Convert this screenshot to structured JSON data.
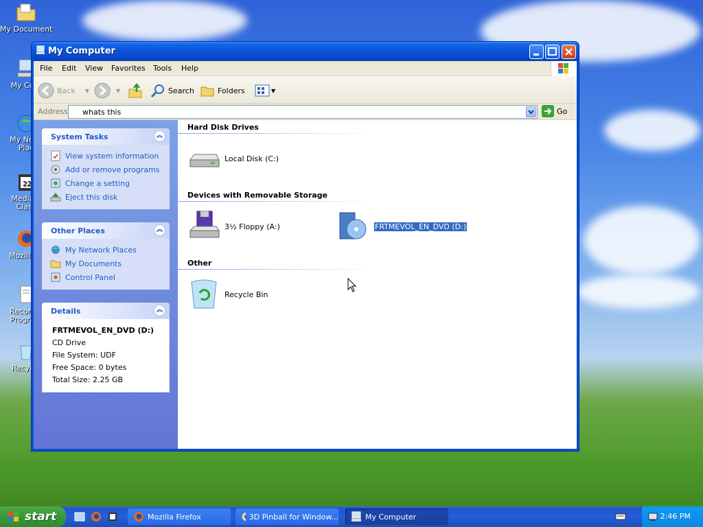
{
  "desktop": {
    "icons": [
      {
        "label": "My Documents",
        "icon": "folder-documents-icon"
      },
      {
        "label": "My Com",
        "icon": "my-computer-icon"
      },
      {
        "label": "My Netw\nPlac",
        "icon": "network-places-icon"
      },
      {
        "label": "Media P\nClass",
        "icon": "media-player-icon"
      },
      {
        "label": "Mozilla Fi",
        "icon": "firefox-icon"
      },
      {
        "label": "Recomm\nProgram",
        "icon": "document-icon"
      },
      {
        "label": "Recycle",
        "icon": "recycle-bin-icon"
      }
    ]
  },
  "window": {
    "title": "My Computer",
    "menu": [
      "File",
      "Edit",
      "View",
      "Favorites",
      "Tools",
      "Help"
    ],
    "toolbar": {
      "back": "Back",
      "search": "Search",
      "folders": "Folders"
    },
    "address": {
      "label": "Address",
      "value": "whats this",
      "go": "Go"
    },
    "taskpane": {
      "system_tasks": {
        "title": "System Tasks",
        "links": [
          "View system information",
          "Add or remove programs",
          "Change a setting",
          "Eject this disk"
        ]
      },
      "other_places": {
        "title": "Other Places",
        "links": [
          "My Network Places",
          "My Documents",
          "Control Panel"
        ]
      },
      "details": {
        "title": "Details",
        "name": "FRTMEVOL_EN_DVD (D:)",
        "type": "CD Drive",
        "file_system": "File System: UDF",
        "free_space": "Free Space: 0 bytes",
        "total_size": "Total Size: 2.25 GB"
      }
    },
    "groups": {
      "hdd": {
        "title": "Hard Disk Drives",
        "items": [
          "Local Disk (C:)"
        ]
      },
      "removable": {
        "title": "Devices with Removable Storage",
        "items": [
          "3½ Floppy (A:)",
          "FRTMEVOL_EN_DVD (D:)"
        ]
      },
      "other": {
        "title": "Other",
        "items": [
          "Recycle Bin"
        ]
      }
    }
  },
  "taskbar": {
    "start": "start",
    "tasks": [
      "Mozilla Firefox",
      "3D Pinball for Window...",
      "My Computer"
    ],
    "clock": "2:46 PM"
  },
  "colors": {
    "xp_blue": "#0a52d8",
    "link_blue": "#215dc6",
    "selection": "#316ac5",
    "start_green": "#3a9b3a"
  }
}
